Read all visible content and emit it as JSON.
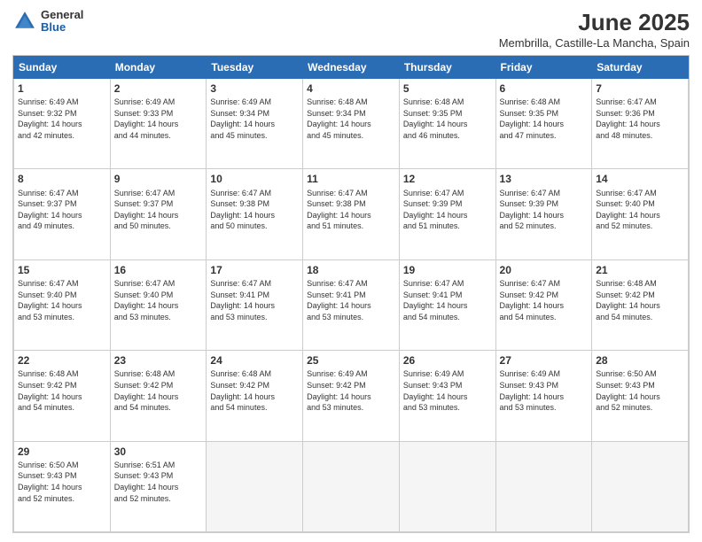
{
  "logo": {
    "general": "General",
    "blue": "Blue"
  },
  "title": "June 2025",
  "subtitle": "Membrilla, Castille-La Mancha, Spain",
  "headers": [
    "Sunday",
    "Monday",
    "Tuesday",
    "Wednesday",
    "Thursday",
    "Friday",
    "Saturday"
  ],
  "weeks": [
    [
      {
        "day": "1",
        "info": "Sunrise: 6:49 AM\nSunset: 9:32 PM\nDaylight: 14 hours\nand 42 minutes."
      },
      {
        "day": "2",
        "info": "Sunrise: 6:49 AM\nSunset: 9:33 PM\nDaylight: 14 hours\nand 44 minutes."
      },
      {
        "day": "3",
        "info": "Sunrise: 6:49 AM\nSunset: 9:34 PM\nDaylight: 14 hours\nand 45 minutes."
      },
      {
        "day": "4",
        "info": "Sunrise: 6:48 AM\nSunset: 9:34 PM\nDaylight: 14 hours\nand 45 minutes."
      },
      {
        "day": "5",
        "info": "Sunrise: 6:48 AM\nSunset: 9:35 PM\nDaylight: 14 hours\nand 46 minutes."
      },
      {
        "day": "6",
        "info": "Sunrise: 6:48 AM\nSunset: 9:35 PM\nDaylight: 14 hours\nand 47 minutes."
      },
      {
        "day": "7",
        "info": "Sunrise: 6:47 AM\nSunset: 9:36 PM\nDaylight: 14 hours\nand 48 minutes."
      }
    ],
    [
      {
        "day": "8",
        "info": "Sunrise: 6:47 AM\nSunset: 9:37 PM\nDaylight: 14 hours\nand 49 minutes."
      },
      {
        "day": "9",
        "info": "Sunrise: 6:47 AM\nSunset: 9:37 PM\nDaylight: 14 hours\nand 50 minutes."
      },
      {
        "day": "10",
        "info": "Sunrise: 6:47 AM\nSunset: 9:38 PM\nDaylight: 14 hours\nand 50 minutes."
      },
      {
        "day": "11",
        "info": "Sunrise: 6:47 AM\nSunset: 9:38 PM\nDaylight: 14 hours\nand 51 minutes."
      },
      {
        "day": "12",
        "info": "Sunrise: 6:47 AM\nSunset: 9:39 PM\nDaylight: 14 hours\nand 51 minutes."
      },
      {
        "day": "13",
        "info": "Sunrise: 6:47 AM\nSunset: 9:39 PM\nDaylight: 14 hours\nand 52 minutes."
      },
      {
        "day": "14",
        "info": "Sunrise: 6:47 AM\nSunset: 9:40 PM\nDaylight: 14 hours\nand 52 minutes."
      }
    ],
    [
      {
        "day": "15",
        "info": "Sunrise: 6:47 AM\nSunset: 9:40 PM\nDaylight: 14 hours\nand 53 minutes."
      },
      {
        "day": "16",
        "info": "Sunrise: 6:47 AM\nSunset: 9:40 PM\nDaylight: 14 hours\nand 53 minutes."
      },
      {
        "day": "17",
        "info": "Sunrise: 6:47 AM\nSunset: 9:41 PM\nDaylight: 14 hours\nand 53 minutes."
      },
      {
        "day": "18",
        "info": "Sunrise: 6:47 AM\nSunset: 9:41 PM\nDaylight: 14 hours\nand 53 minutes."
      },
      {
        "day": "19",
        "info": "Sunrise: 6:47 AM\nSunset: 9:41 PM\nDaylight: 14 hours\nand 54 minutes."
      },
      {
        "day": "20",
        "info": "Sunrise: 6:47 AM\nSunset: 9:42 PM\nDaylight: 14 hours\nand 54 minutes."
      },
      {
        "day": "21",
        "info": "Sunrise: 6:48 AM\nSunset: 9:42 PM\nDaylight: 14 hours\nand 54 minutes."
      }
    ],
    [
      {
        "day": "22",
        "info": "Sunrise: 6:48 AM\nSunset: 9:42 PM\nDaylight: 14 hours\nand 54 minutes."
      },
      {
        "day": "23",
        "info": "Sunrise: 6:48 AM\nSunset: 9:42 PM\nDaylight: 14 hours\nand 54 minutes."
      },
      {
        "day": "24",
        "info": "Sunrise: 6:48 AM\nSunset: 9:42 PM\nDaylight: 14 hours\nand 54 minutes."
      },
      {
        "day": "25",
        "info": "Sunrise: 6:49 AM\nSunset: 9:42 PM\nDaylight: 14 hours\nand 53 minutes."
      },
      {
        "day": "26",
        "info": "Sunrise: 6:49 AM\nSunset: 9:43 PM\nDaylight: 14 hours\nand 53 minutes."
      },
      {
        "day": "27",
        "info": "Sunrise: 6:49 AM\nSunset: 9:43 PM\nDaylight: 14 hours\nand 53 minutes."
      },
      {
        "day": "28",
        "info": "Sunrise: 6:50 AM\nSunset: 9:43 PM\nDaylight: 14 hours\nand 52 minutes."
      }
    ],
    [
      {
        "day": "29",
        "info": "Sunrise: 6:50 AM\nSunset: 9:43 PM\nDaylight: 14 hours\nand 52 minutes."
      },
      {
        "day": "30",
        "info": "Sunrise: 6:51 AM\nSunset: 9:43 PM\nDaylight: 14 hours\nand 52 minutes."
      },
      {
        "day": "",
        "info": ""
      },
      {
        "day": "",
        "info": ""
      },
      {
        "day": "",
        "info": ""
      },
      {
        "day": "",
        "info": ""
      },
      {
        "day": "",
        "info": ""
      }
    ]
  ]
}
